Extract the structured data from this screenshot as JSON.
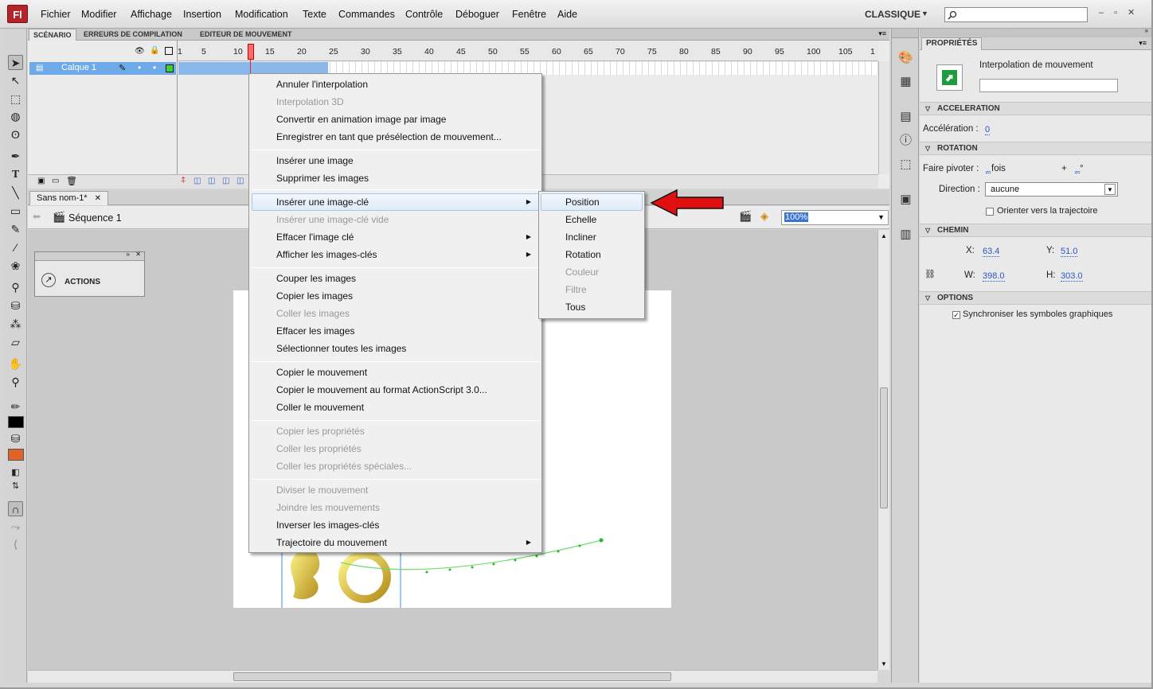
{
  "menubar": {
    "logo": "Fl",
    "items": [
      "Fichier",
      "Modifier",
      "Affichage",
      "Insertion",
      "Modification",
      "Texte",
      "Commandes",
      "Contrôle",
      "Déboguer",
      "Fenêtre",
      "Aide"
    ],
    "workspace": "CLASSIQUE",
    "search_placeholder": ""
  },
  "timeline": {
    "tabs": [
      "SCÉNARIO",
      "ERREURS DE COMPILATION",
      "EDITEUR DE MOUVEMENT"
    ],
    "layer_name": "Calque 1",
    "ruler": [
      "1",
      "5",
      "10",
      "15",
      "20",
      "25",
      "30",
      "35",
      "40",
      "45",
      "50",
      "55",
      "60",
      "65",
      "70",
      "75",
      "80",
      "85",
      "90",
      "95",
      "100",
      "105",
      "1"
    ],
    "current_frame": 12
  },
  "document": {
    "tab": "Sans nom-1*",
    "scene": "Séquence 1",
    "zoom": "100%"
  },
  "actions_panel": {
    "label": "ACTIONS"
  },
  "context_menu": {
    "items": [
      {
        "label": "Annuler l'interpolation",
        "enabled": true
      },
      {
        "label": "Interpolation 3D",
        "enabled": false
      },
      {
        "label": "Convertir en animation image par image",
        "enabled": true
      },
      {
        "label": "Enregistrer en tant que présélection de mouvement...",
        "enabled": true
      },
      {
        "label": "Insérer une image",
        "enabled": true
      },
      {
        "label": "Supprimer les images",
        "enabled": true
      },
      {
        "label": "Insérer une image-clé",
        "enabled": true,
        "submenu": true,
        "highlighted": true
      },
      {
        "label": "Insérer une image-clé vide",
        "enabled": false
      },
      {
        "label": "Effacer l'image clé",
        "enabled": true,
        "submenu": true
      },
      {
        "label": "Afficher les images-clés",
        "enabled": true,
        "submenu": true
      },
      {
        "label": "Couper les images",
        "enabled": true
      },
      {
        "label": "Copier les images",
        "enabled": true
      },
      {
        "label": "Coller les images",
        "enabled": false
      },
      {
        "label": "Effacer les images",
        "enabled": true
      },
      {
        "label": "Sélectionner toutes les images",
        "enabled": true
      },
      {
        "label": "Copier le mouvement",
        "enabled": true
      },
      {
        "label": "Copier le mouvement au format ActionScript 3.0...",
        "enabled": true
      },
      {
        "label": "Coller le mouvement",
        "enabled": true
      },
      {
        "label": "Copier les propriétés",
        "enabled": false
      },
      {
        "label": "Coller les propriétés",
        "enabled": false
      },
      {
        "label": "Coller les propriétés spéciales...",
        "enabled": false
      },
      {
        "label": "Diviser le mouvement",
        "enabled": false
      },
      {
        "label": "Joindre les mouvements",
        "enabled": false
      },
      {
        "label": "Inverser les images-clés",
        "enabled": true
      },
      {
        "label": "Trajectoire du mouvement",
        "enabled": true,
        "submenu": true
      }
    ]
  },
  "submenu": {
    "items": [
      {
        "label": "Position",
        "enabled": true,
        "highlighted": true
      },
      {
        "label": "Echelle",
        "enabled": true
      },
      {
        "label": "Incliner",
        "enabled": true
      },
      {
        "label": "Rotation",
        "enabled": true
      },
      {
        "label": "Couleur",
        "enabled": false
      },
      {
        "label": "Filtre",
        "enabled": false
      },
      {
        "label": "Tous",
        "enabled": true
      }
    ]
  },
  "properties": {
    "tab": "PROPRIÉTÉS",
    "type_label": "Interpolation de mouvement",
    "instance_name": "",
    "sections": {
      "acceleration": "ACCELERATION",
      "rotation": "ROTATION",
      "chemin": "CHEMIN",
      "options": "OPTIONS"
    },
    "acceleration_label": "Accélération :",
    "acceleration_value": "0",
    "pivot_label": "Faire pivoter :",
    "pivot_count": "_",
    "pivot_unit": "fois",
    "pivot_plus": "+",
    "pivot_deg": "_",
    "pivot_deg_unit": "°",
    "direction_label": "Direction :",
    "direction_value": "aucune",
    "orient_label": "Orienter vers la trajectoire",
    "x_label": "X:",
    "x_value": "63.4",
    "y_label": "Y:",
    "y_value": "51.0",
    "w_label": "W:",
    "w_value": "398.0",
    "h_label": "H:",
    "h_value": "303.0",
    "sync_label": "Synchroniser les symboles graphiques"
  },
  "colors": {
    "stroke": "#000000",
    "fill": "#e0642a",
    "arrow": "#e01010",
    "highlight": "#dfebf8"
  }
}
